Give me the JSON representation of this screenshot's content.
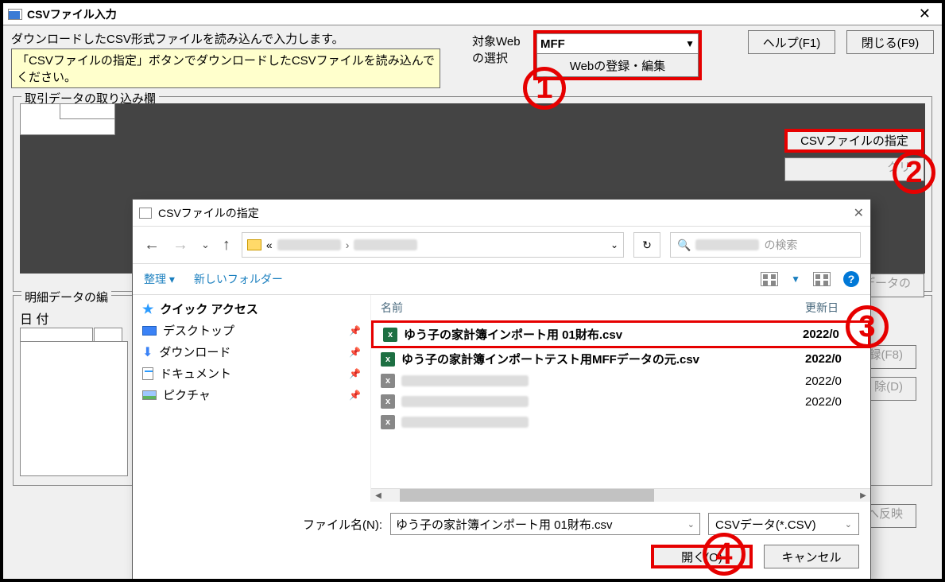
{
  "titlebar": {
    "title": "CSVファイル入力"
  },
  "subtitle": "ダウンロードしたCSV形式ファイルを読み込んで入力します。",
  "instruction": "「CSVファイルの指定」ボタンでダウンロードしたCSVファイルを読み込んでください。",
  "webSelect": {
    "label": "対象Webの選択",
    "value": "MFF",
    "editBtn": "Webの登録・編集"
  },
  "buttons": {
    "help": "ヘルプ(F1)",
    "close": "閉じる(F9)",
    "csvSpec": "CSVファイルの指定",
    "clear": "クリ",
    "detailData": "明細データの",
    "register": "録(F8)",
    "delete": "削 除(D)",
    "reflect": "反へ反映"
  },
  "groups": {
    "import": "取引データの取り込み欄",
    "detail": "明細データの編",
    "date": "日 付"
  },
  "dialog": {
    "title": "CSVファイルの指定",
    "pathPrefix": "«",
    "searchSuffix": "の検索",
    "organize": "整理",
    "newFolder": "新しいフォルダー",
    "headerName": "名前",
    "headerDate": "更新日",
    "tree": {
      "quick": "クイック アクセス",
      "desktop": "デスクトップ",
      "downloads": "ダウンロード",
      "documents": "ドキュメント",
      "pictures": "ピクチャ"
    },
    "files": [
      {
        "name": "ゆう子の家計簿インポート用 01財布.csv",
        "date": "2022/0",
        "selected": true,
        "bold": true
      },
      {
        "name": "ゆう子の家計簿インポートテスト用MFFデータの元.csv",
        "date": "2022/0",
        "selected": false,
        "bold": true
      },
      {
        "name": "",
        "date": "2022/0",
        "selected": false,
        "bold": false
      },
      {
        "name": "",
        "date": "2022/0",
        "selected": false,
        "bold": false
      },
      {
        "name": "",
        "date": "",
        "selected": false,
        "bold": false
      }
    ],
    "fnLabel": "ファイル名(N):",
    "fnValue": "ゆう子の家計簿インポート用 01財布.csv",
    "typeValue": "CSVデータ(*.CSV)",
    "openBtn": "開く(O)",
    "cancelBtn": "キャンセル"
  },
  "callouts": {
    "one": "1",
    "two": "2",
    "three": "3",
    "four": "4"
  }
}
